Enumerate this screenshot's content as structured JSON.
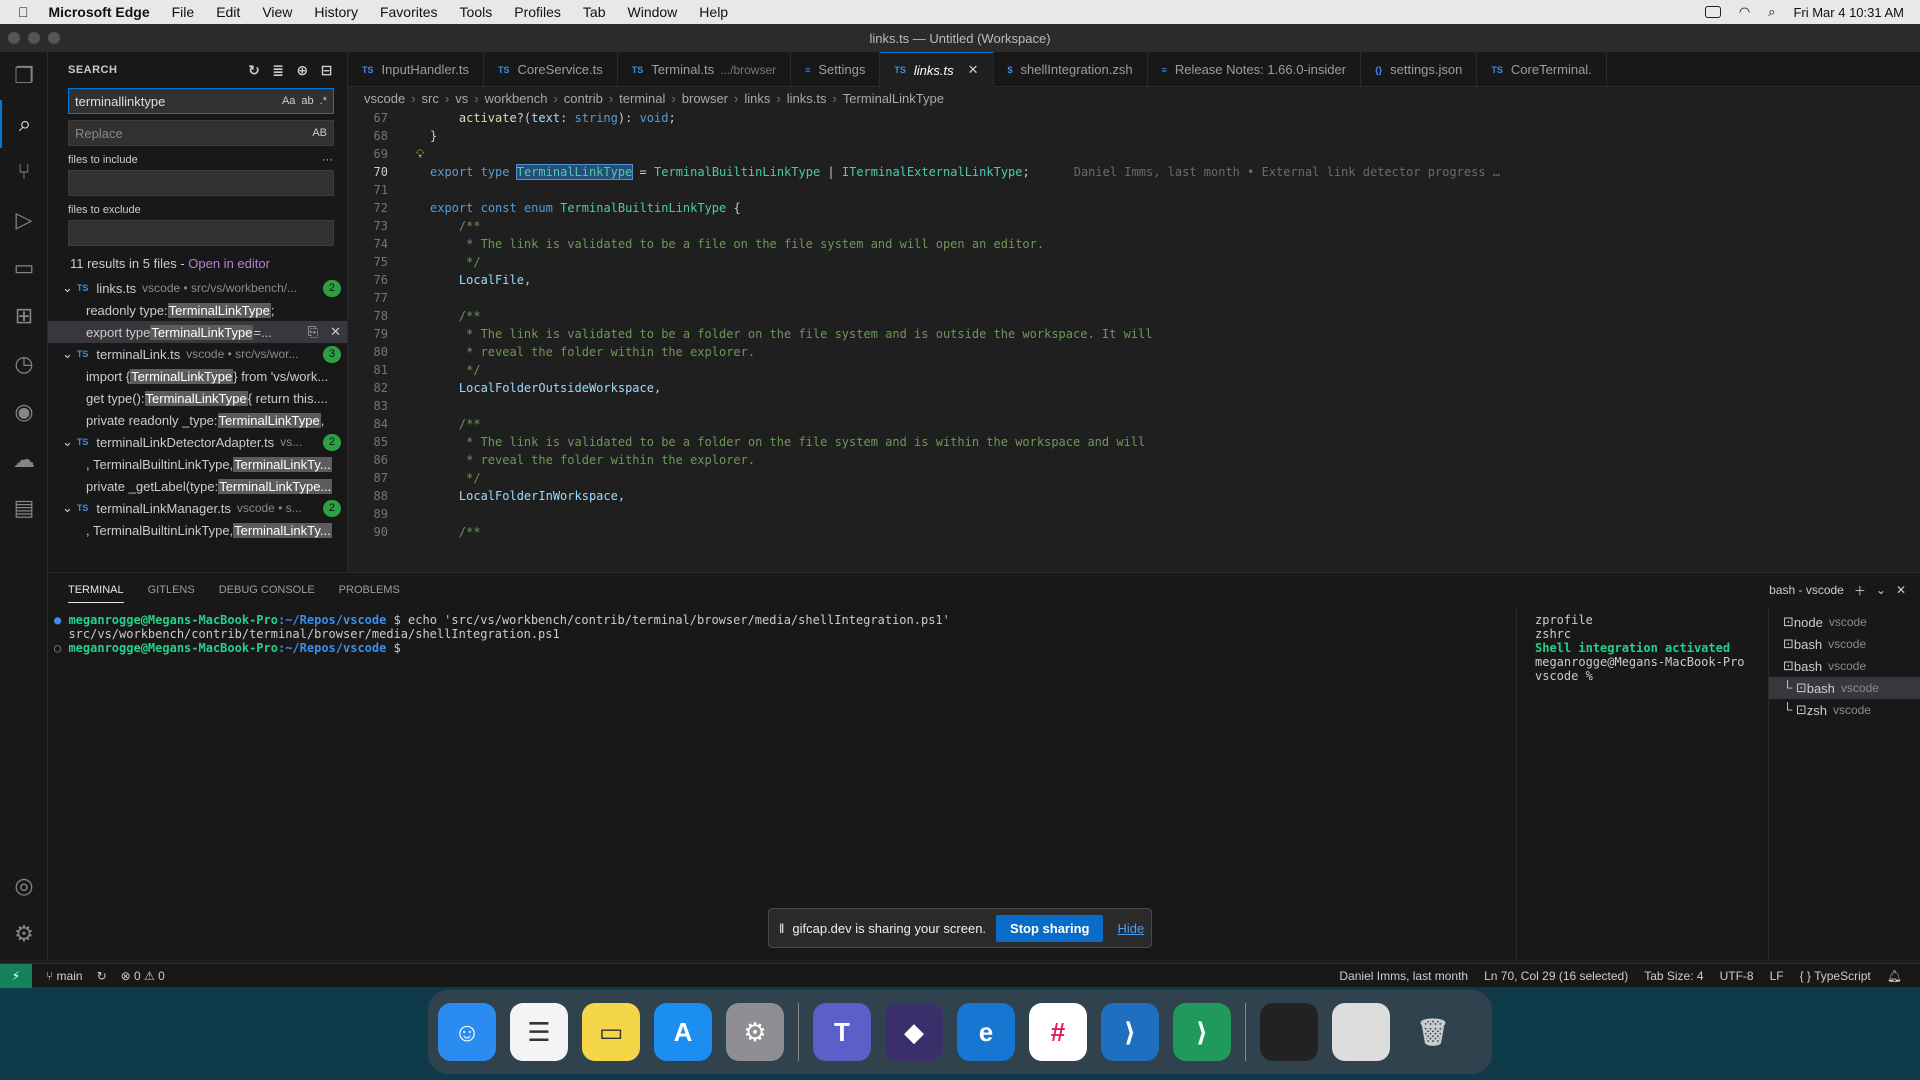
{
  "menubar": {
    "app": "Microsoft Edge",
    "items": [
      "File",
      "Edit",
      "View",
      "History",
      "Favorites",
      "Tools",
      "Profiles",
      "Tab",
      "Window",
      "Help"
    ],
    "clock": "Fri Mar 4  10:31 AM"
  },
  "window": {
    "title": "links.ts — Untitled (Workspace)"
  },
  "search": {
    "header": "SEARCH",
    "query": "terminallinktype",
    "replace_placeholder": "Replace",
    "include_label": "files to include",
    "exclude_label": "files to exclude",
    "results_text": "11 results in 5 files - ",
    "open_in_editor": "Open in editor",
    "groups": [
      {
        "file": "links.ts",
        "path": "vscode • src/vs/workbench/...",
        "count": "2",
        "matches": [
          {
            "pre": "readonly type: ",
            "hit": "TerminalLinkType",
            "post": ";"
          },
          {
            "pre": "export type ",
            "hit": "TerminalLinkType",
            "post": " =..."
          }
        ]
      },
      {
        "file": "terminalLink.ts",
        "path": "vscode • src/vs/wor...",
        "count": "3",
        "matches": [
          {
            "pre": "import { ",
            "hit": "TerminalLinkType",
            "post": " } from 'vs/work..."
          },
          {
            "pre": "get type(): ",
            "hit": "TerminalLinkType",
            "post": " { return this...."
          },
          {
            "pre": "private readonly _type: ",
            "hit": "TerminalLinkType",
            "post": ","
          }
        ]
      },
      {
        "file": "terminalLinkDetectorAdapter.ts",
        "path": "vs...",
        "count": "2",
        "matches": [
          {
            "pre": ", TerminalBuiltinLinkType, ",
            "hit": "TerminalLinkTy...",
            "post": ""
          },
          {
            "pre": "private _getLabel(type: ",
            "hit": "TerminalLinkType...",
            "post": ""
          }
        ]
      },
      {
        "file": "terminalLinkManager.ts",
        "path": "vscode • s...",
        "count": "2",
        "matches": [
          {
            "pre": ", TerminalBuiltinLinkType, ",
            "hit": "TerminalLinkTy...",
            "post": ""
          }
        ]
      }
    ]
  },
  "tabs": [
    {
      "label": "InputHandler.ts",
      "icon": "TS",
      "desc": ""
    },
    {
      "label": "CoreService.ts",
      "icon": "TS",
      "desc": ""
    },
    {
      "label": "Terminal.ts",
      "icon": "TS",
      "desc": ".../browser"
    },
    {
      "label": "Settings",
      "icon": "≡",
      "desc": ""
    },
    {
      "label": "links.ts",
      "icon": "TS",
      "desc": "",
      "active": true
    },
    {
      "label": "shellIntegration.zsh",
      "icon": "$",
      "desc": ""
    },
    {
      "label": "Release Notes: 1.66.0-insider",
      "icon": "≡",
      "desc": ""
    },
    {
      "label": "settings.json",
      "icon": "{}",
      "desc": ""
    },
    {
      "label": "CoreTerminal.",
      "icon": "TS",
      "desc": ""
    }
  ],
  "breadcrumbs": [
    "vscode",
    "src",
    "vs",
    "workbench",
    "contrib",
    "terminal",
    "browser",
    "links",
    "links.ts",
    "TerminalLinkType"
  ],
  "code": [
    {
      "n": "67",
      "t": "    activate?(text: string): void;"
    },
    {
      "n": "68",
      "t": "}"
    },
    {
      "n": "69",
      "t": ""
    },
    {
      "n": "70",
      "t": "export type TerminalLinkType = TerminalBuiltinLinkType | ITerminalExternalLinkType;",
      "cur": true,
      "ghost": "Daniel Imms, last month • External link detector progress …"
    },
    {
      "n": "71",
      "t": ""
    },
    {
      "n": "72",
      "t": "export const enum TerminalBuiltinLinkType {"
    },
    {
      "n": "73",
      "t": "    /**"
    },
    {
      "n": "74",
      "t": "     * The link is validated to be a file on the file system and will open an editor."
    },
    {
      "n": "75",
      "t": "     */"
    },
    {
      "n": "76",
      "t": "    LocalFile,"
    },
    {
      "n": "77",
      "t": ""
    },
    {
      "n": "78",
      "t": "    /**"
    },
    {
      "n": "79",
      "t": "     * The link is validated to be a folder on the file system and is outside the workspace. It will"
    },
    {
      "n": "80",
      "t": "     * reveal the folder within the explorer."
    },
    {
      "n": "81",
      "t": "     */"
    },
    {
      "n": "82",
      "t": "    LocalFolderOutsideWorkspace,"
    },
    {
      "n": "83",
      "t": ""
    },
    {
      "n": "84",
      "t": "    /**"
    },
    {
      "n": "85",
      "t": "     * The link is validated to be a folder on the file system and is within the workspace and will"
    },
    {
      "n": "86",
      "t": "     * reveal the folder within the explorer."
    },
    {
      "n": "87",
      "t": "     */"
    },
    {
      "n": "88",
      "t": "    LocalFolderInWorkspace,"
    },
    {
      "n": "89",
      "t": ""
    },
    {
      "n": "90",
      "t": "    /**"
    }
  ],
  "panel": {
    "tabs": [
      "TERMINAL",
      "GITLENS",
      "DEBUG CONSOLE",
      "PROBLEMS"
    ],
    "active_terminal": "bash - vscode",
    "lines": [
      {
        "user": "meganrogge@Megans-MacBook-Pro",
        "path": ":~/Repos/vscode",
        "cmd": " $ echo 'src/vs/workbench/contrib/terminal/browser/media/shellIntegration.ps1'"
      },
      {
        "out": "  src/vs/workbench/contrib/terminal/browser/media/shellIntegration.ps1"
      },
      {
        "user": "meganrogge@Megans-MacBook-Pro",
        "path": ":~/Repos/vscode",
        "cmd": " $ "
      }
    ],
    "right_lines": [
      "zprofile",
      "zshrc",
      "Shell integration activated",
      "meganrogge@Megans-MacBook-Pro",
      "vscode % "
    ],
    "terminals": [
      {
        "name": "node",
        "desc": "vscode"
      },
      {
        "name": "bash",
        "desc": "vscode"
      },
      {
        "name": "bash",
        "desc": "vscode"
      },
      {
        "name": "bash",
        "desc": "vscode",
        "active": true
      },
      {
        "name": "zsh",
        "desc": "vscode"
      }
    ]
  },
  "status": {
    "branch": "main",
    "problems": "⊗ 0 ⚠ 0",
    "blame": "Daniel Imms, last month",
    "pos": "Ln 70, Col 29 (16 selected)",
    "tab": "Tab Size: 4",
    "enc": "UTF-8",
    "eol": "LF",
    "lang": "TypeScript"
  },
  "share": {
    "text": "gifcap.dev is sharing your screen.",
    "stop": "Stop sharing",
    "hide": "Hide"
  }
}
